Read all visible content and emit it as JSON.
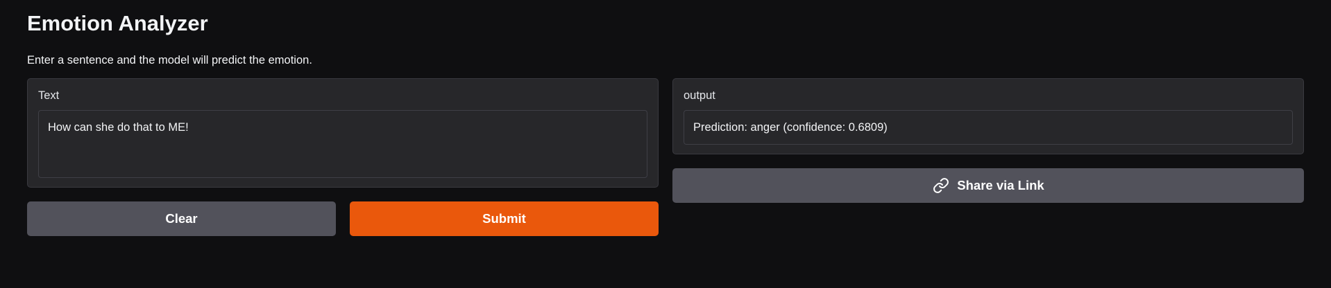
{
  "app": {
    "title": "Emotion Analyzer",
    "description": "Enter a sentence and the model will predict the emotion."
  },
  "input": {
    "label": "Text",
    "value": "How can she do that to ME!"
  },
  "output": {
    "label": "output",
    "value": "Prediction: anger (confidence: 0.6809)"
  },
  "buttons": {
    "clear_label": "Clear",
    "submit_label": "Submit",
    "share_label": "Share via Link",
    "share_icon": "link-icon"
  },
  "colors": {
    "background": "#0f0f11",
    "panel": "#27272a",
    "secondary_button": "#52525b",
    "primary_button": "#ea580c",
    "text": "#f3f4f6"
  }
}
